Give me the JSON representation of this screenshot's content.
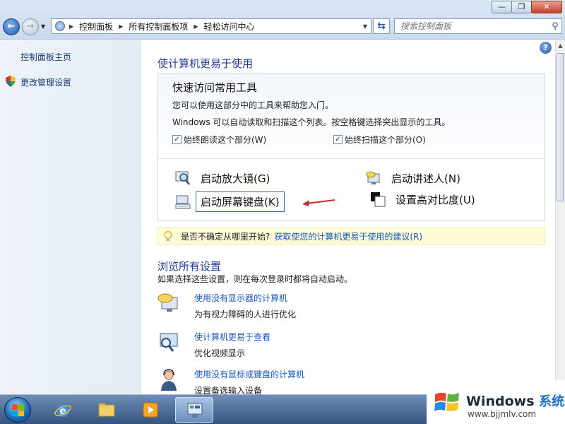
{
  "window": {
    "minimize_glyph": "—",
    "maximize_glyph": "❐",
    "close_glyph": "✕"
  },
  "address_bar": {
    "crumbs": [
      "控制面板",
      "所有控制面板项",
      "轻松访问中心"
    ],
    "search_placeholder": "搜索控制面板"
  },
  "sidebar": {
    "home_link": "控制面板主页",
    "admin_link": "更改管理设置"
  },
  "main": {
    "title": "使计算机更易于使用",
    "quick": {
      "heading": "快速访问常用工具",
      "line1": "您可以使用这部分中的工具来帮助您入门。",
      "line2": "Windows 可以自动读取和扫描这个列表。按空格键选择突出显示的工具。",
      "checkbox_read": "始终朗读这个部分(W)",
      "checkbox_scan": "始终扫描这个部分(O)",
      "tools": {
        "magnifier": "启动放大镜(G)",
        "narrator": "启动讲述人(N)",
        "osk": "启动屏幕键盘(K)",
        "contrast": "设置高对比度(U)"
      }
    },
    "tip": {
      "text": "是否不确定从哪里开始?",
      "link": "获取使您的计算机更易于使用的建议(R)"
    },
    "browse": {
      "title": "浏览所有设置",
      "subtitle": "如果选择这些设置，则在每次登录时都将自动启动。",
      "options": [
        {
          "link": "使用没有显示器的计算机",
          "desc": "为有视力障碍的人进行优化"
        },
        {
          "link": "使计算机更易于查看",
          "desc": "优化视频显示"
        },
        {
          "link": "使用没有鼠标或键盘的计算机",
          "desc": "设置备选输入设备"
        }
      ]
    }
  },
  "taskbar": {
    "apps": [
      "start-orb",
      "internet-explorer-icon",
      "explorer-folder-icon",
      "media-player-icon",
      "control-panel-icon"
    ]
  },
  "watermark": {
    "brand": "Windows",
    "brand_cn": "系统之家",
    "url": "www.bjjmlv.com"
  },
  "colors": {
    "link": "#1a58b8",
    "heading": "#1e3d8f",
    "annotation_arrow": "#d22a2a"
  }
}
